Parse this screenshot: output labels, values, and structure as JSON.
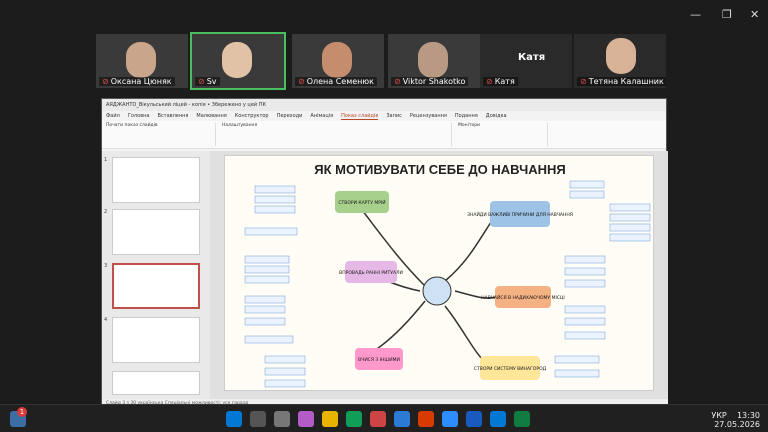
{
  "participants": [
    {
      "name": "Оксана Цюняк",
      "muted": true
    },
    {
      "name": "Sv",
      "muted": true,
      "active": true
    },
    {
      "name": "Олена Семенюк",
      "muted": true
    },
    {
      "name": "Viktor Shakotko",
      "muted": true
    },
    {
      "name": "Катя",
      "muted": true
    },
    {
      "name": "Тетяна Калашник",
      "muted": true
    }
  ],
  "speaker_name": "Катя",
  "app": {
    "title": "АЯДЖАНТО_Вікульський ліцей - копія • Збережено у цей ПК",
    "menu": [
      "Файл",
      "Головна",
      "Вставлення",
      "Малювання",
      "Конструктор",
      "Переходи",
      "Анімація",
      "Показ слайдів",
      "Запис",
      "Рецензування",
      "Подання",
      "Довідка"
    ],
    "selected_menu": "Показ слайдів",
    "ribbon_groups": [
      "Почати показ слайдів",
      "Налаштування",
      "Монітори"
    ],
    "status": "Слайд 3 з 30   українська   Спеціальні можливості: усе гаразд"
  },
  "slide": {
    "title": "ЯК МОТИВУВАТИ СЕБЕ ДО НАВЧАННЯ",
    "branches": [
      {
        "label": "СТВОРИ КАРТУ МРІЙ",
        "color": "#a8d08d"
      },
      {
        "label": "ЗНАЙДИ ВАЖЛИВІ ПРИЧИНИ ДЛЯ НАВЧАННЯ",
        "color": "#9dc3e6"
      },
      {
        "label": "ВПРОВАДЬ РАННІ РИТУАЛИ",
        "color": "#e6b8e6"
      },
      {
        "label": "НАВЧАЙСЯ В НАДИХАЮЧОМУ МІСЦІ",
        "color": "#f4b183"
      },
      {
        "label": "ВЧИСЯ З ІНШИМИ",
        "color": "#ff99cc"
      },
      {
        "label": "СТВОРИ СИСТЕМУ ВИНАГОРОД",
        "color": "#ffe699"
      }
    ]
  },
  "taskbar": {
    "time": "13:30",
    "date": "27.05.2026",
    "lang": "УКР",
    "notifications": "1"
  }
}
